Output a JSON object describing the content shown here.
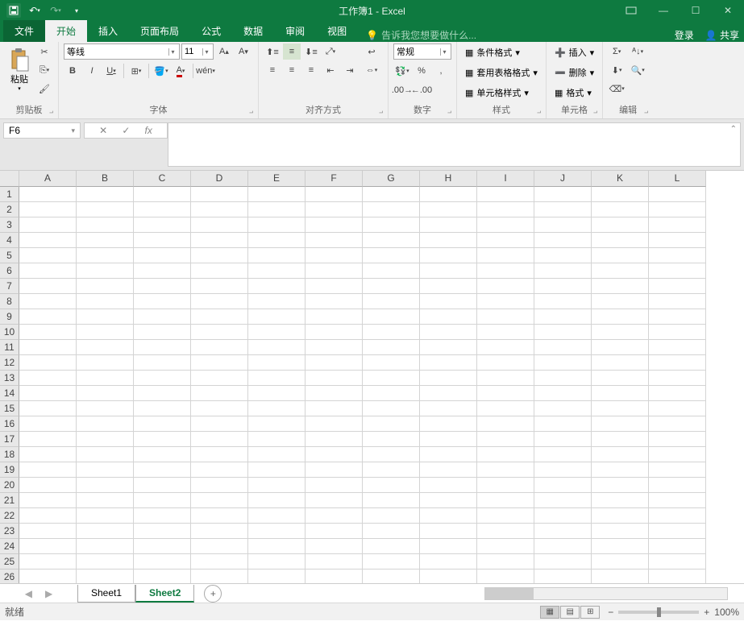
{
  "title": "工作簿1 - Excel",
  "tabs": {
    "file": "文件",
    "home": "开始",
    "insert": "插入",
    "layout": "页面布局",
    "formulas": "公式",
    "data": "数据",
    "review": "审阅",
    "view": "视图",
    "tellme": "告诉我您想要做什么...",
    "login": "登录",
    "share": "共享"
  },
  "ribbon": {
    "clipboard": {
      "paste": "粘贴",
      "label": "剪贴板"
    },
    "font": {
      "name": "等线",
      "size": "11",
      "label": "字体",
      "bold": "B",
      "italic": "I",
      "underline": "U",
      "pinyin": "wén"
    },
    "align": {
      "label": "对齐方式"
    },
    "number": {
      "format": "常规",
      "label": "数字"
    },
    "styles": {
      "cond": "条件格式",
      "table": "套用表格格式",
      "cell": "单元格样式",
      "label": "样式"
    },
    "cells": {
      "insert": "插入",
      "delete": "删除",
      "format": "格式",
      "label": "单元格"
    },
    "editing": {
      "label": "编辑"
    }
  },
  "name_box": "F6",
  "columns": [
    "A",
    "B",
    "C",
    "D",
    "E",
    "F",
    "G",
    "H",
    "I",
    "J",
    "K",
    "L"
  ],
  "rows": [
    "1",
    "2",
    "3",
    "4",
    "5",
    "6",
    "7",
    "8",
    "9",
    "10",
    "11",
    "12",
    "13",
    "14",
    "15",
    "16",
    "17",
    "18",
    "19",
    "20",
    "21",
    "22",
    "23",
    "24",
    "25",
    "26"
  ],
  "sheets": [
    "Sheet1",
    "Sheet2"
  ],
  "active_sheet": 1,
  "status": "就绪",
  "zoom": "100%"
}
